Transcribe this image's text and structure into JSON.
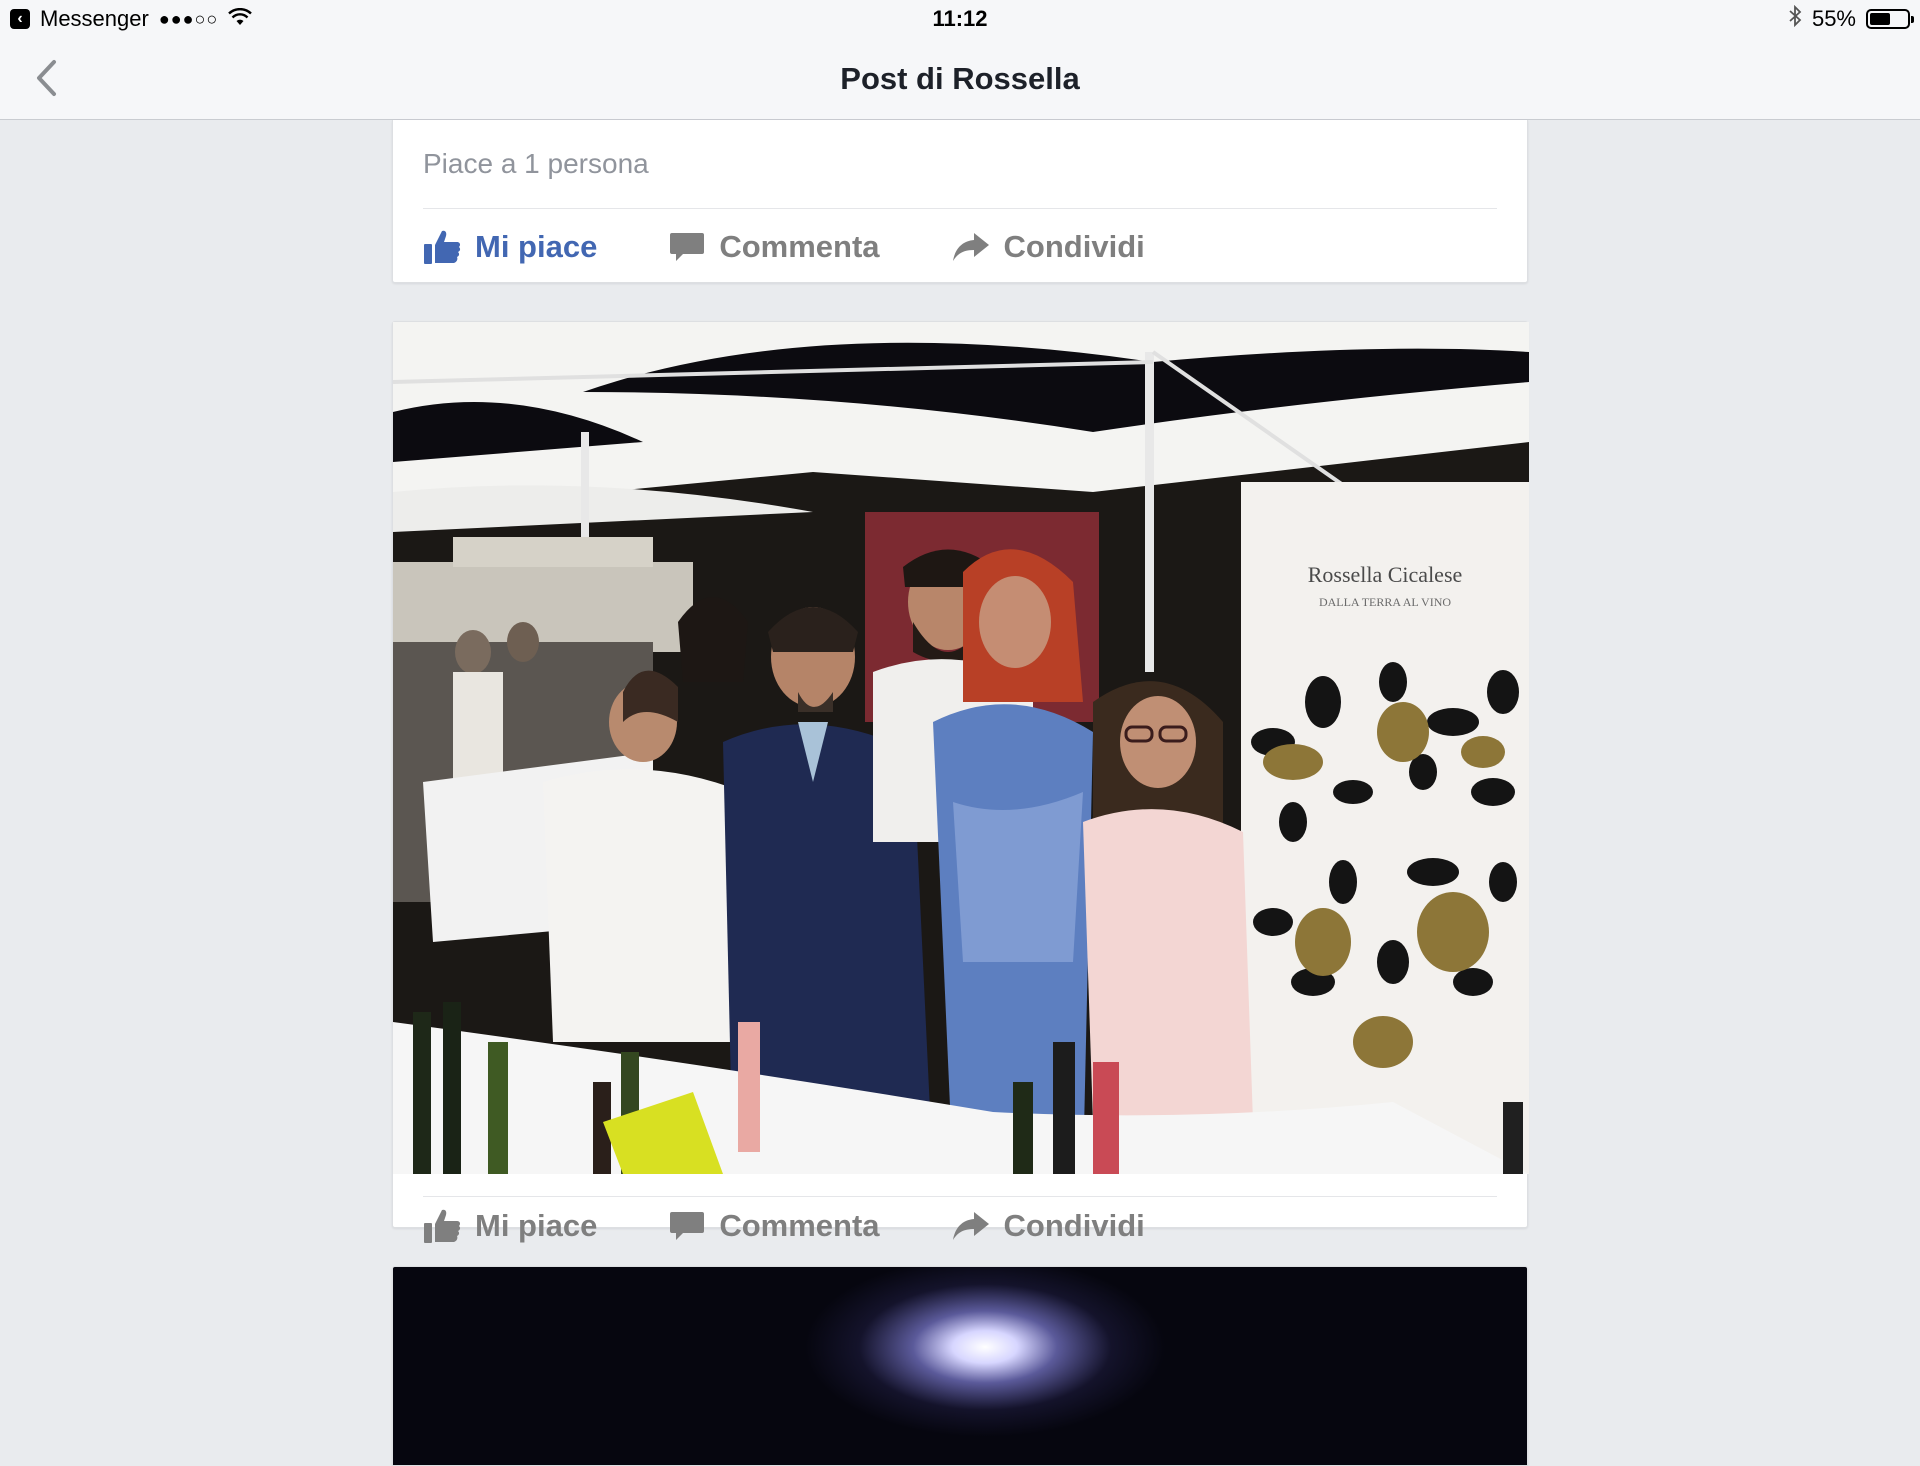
{
  "status_bar": {
    "back_app": "Messenger",
    "signal": "●●●○○",
    "time": "11:12",
    "battery_text": "55%",
    "battery_level": 0.55
  },
  "nav": {
    "title": "Post di Rossella"
  },
  "post1": {
    "likes_summary": "Piace a 1 persona",
    "actions": {
      "like": "Mi piace",
      "comment": "Commenta",
      "share": "Condividi"
    },
    "like_active": true
  },
  "post2": {
    "photo_banner_title": "Rossella Cicalese",
    "photo_banner_subtitle": "DALLA TERRA AL VINO",
    "actions": {
      "like": "Mi piace",
      "comment": "Commenta",
      "share": "Condividi"
    },
    "like_active": false
  },
  "colors": {
    "accent": "#4267b2",
    "muted_action": "#7f7f7f",
    "background": "#e9ebee"
  }
}
